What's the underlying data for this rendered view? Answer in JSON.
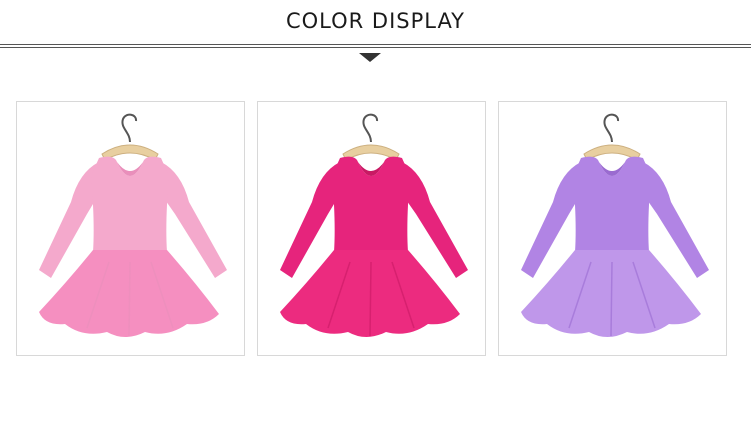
{
  "header": {
    "title": "COLOR DISPLAY"
  },
  "products": [
    {
      "color_name": "pink",
      "dress_color": "#f4a9cc",
      "shade_color": "#e98fbb",
      "skirt_color": "#f58fc0"
    },
    {
      "color_name": "rose-red",
      "dress_color": "#e6247c",
      "shade_color": "#c91964",
      "skirt_color": "#ec2b7f"
    },
    {
      "color_name": "purple",
      "dress_color": "#b184e4",
      "shade_color": "#9a6bd0",
      "skirt_color": "#bf97ea"
    }
  ],
  "hanger": {
    "hook_color": "#555555",
    "wood_color": "#e8cfa0"
  }
}
